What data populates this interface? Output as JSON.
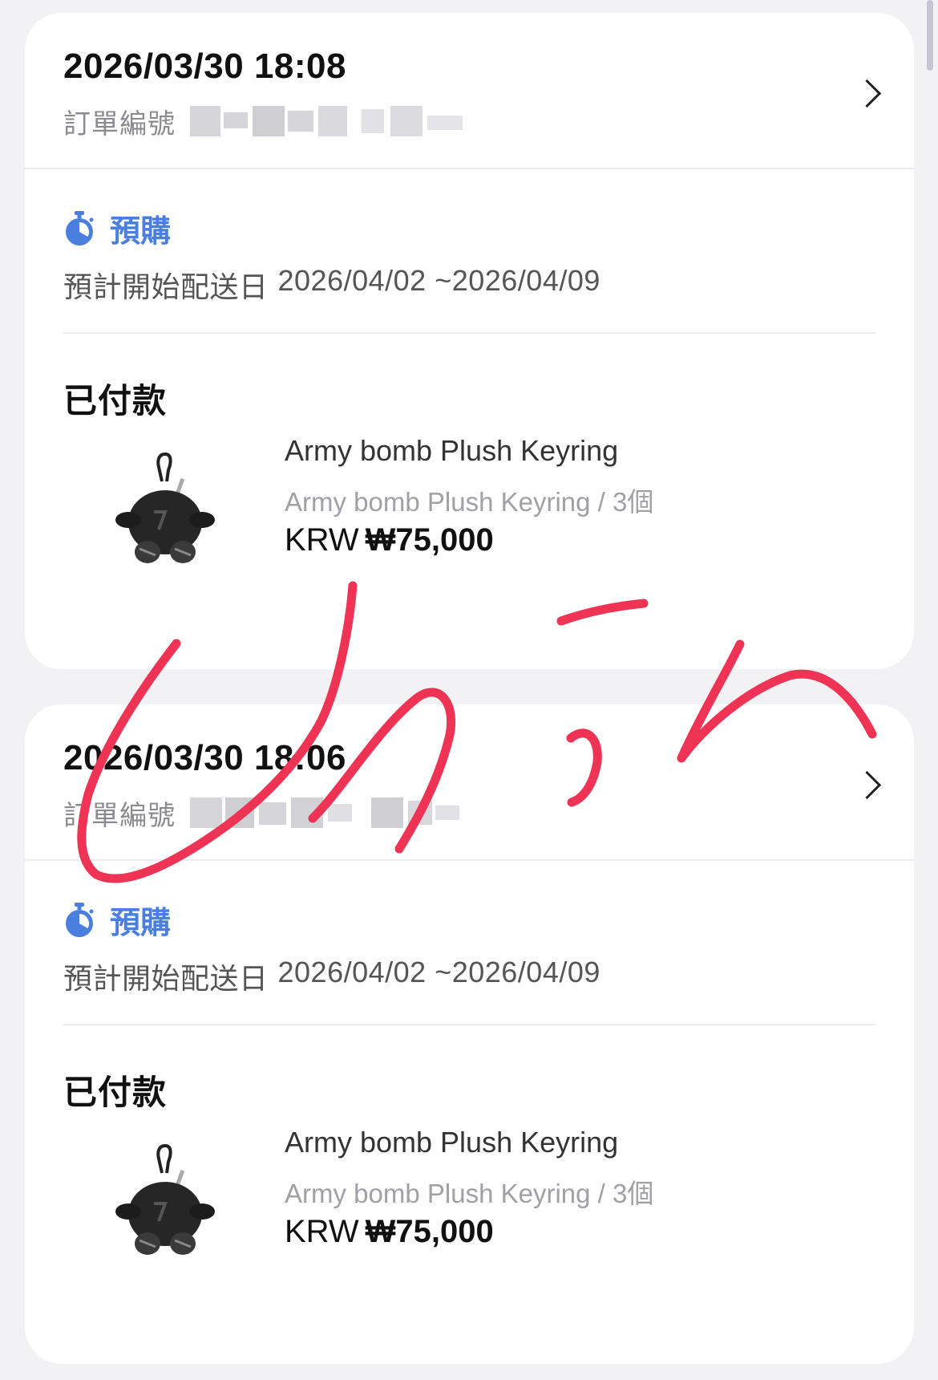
{
  "orders": [
    {
      "datetime": "2026/03/30 18:08",
      "order_no_label": "訂單編號",
      "preorder_tag": "預購",
      "ship_label": "預計開始配送日",
      "ship_range": "2026/04/02 ~2026/04/09",
      "status": "已付款",
      "product": {
        "name": "Army bomb Plush Keyring",
        "option": "Army bomb Plush Keyring / 3個",
        "currency": "KRW",
        "price": "₩75,000"
      }
    },
    {
      "datetime": "2026/03/30 18:06",
      "order_no_label": "訂單編號",
      "preorder_tag": "預購",
      "ship_label": "預計開始配送日",
      "ship_range": "2026/04/02 ~2026/04/09",
      "status": "已付款",
      "product": {
        "name": "Army bomb Plush Keyring",
        "option": "Army bomb Plush Keyring / 3個",
        "currency": "KRW",
        "price": "₩75,000"
      }
    }
  ],
  "colors": {
    "accent": "#4a7fe0",
    "background": "#f2f2f5",
    "signature": "#ee3355"
  },
  "icons": [
    "chevron-right-icon",
    "timer-icon",
    "product-thumbnail"
  ]
}
